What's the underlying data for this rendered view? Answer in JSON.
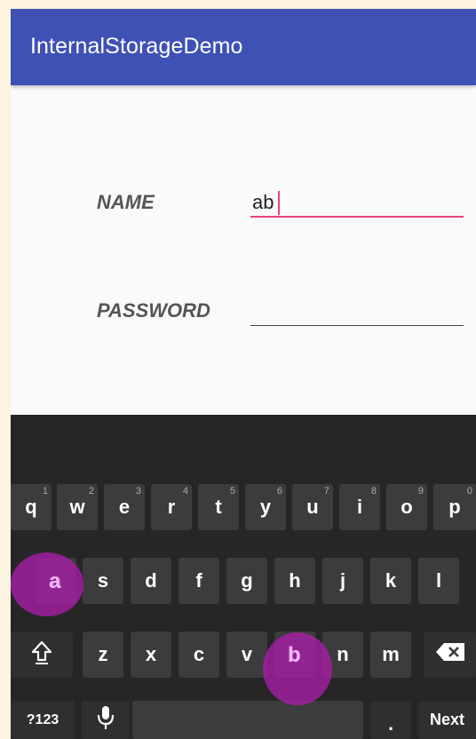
{
  "app": {
    "title": "InternalStorageDemo"
  },
  "form": {
    "name_label": "NAME",
    "name_value": "ab",
    "password_label": "PASSWORD",
    "password_value": ""
  },
  "keyboard": {
    "row1": [
      {
        "label": "q",
        "hint": "1"
      },
      {
        "label": "w",
        "hint": "2"
      },
      {
        "label": "e",
        "hint": "3"
      },
      {
        "label": "r",
        "hint": "4"
      },
      {
        "label": "t",
        "hint": "5"
      },
      {
        "label": "y",
        "hint": "6"
      },
      {
        "label": "u",
        "hint": "7"
      },
      {
        "label": "i",
        "hint": "8"
      },
      {
        "label": "o",
        "hint": "9"
      },
      {
        "label": "p",
        "hint": "0"
      }
    ],
    "row2": [
      "a",
      "s",
      "d",
      "f",
      "g",
      "h",
      "j",
      "k",
      "l"
    ],
    "row3": [
      "z",
      "x",
      "c",
      "v",
      "b",
      "n",
      "m"
    ],
    "shift_icon": "shift-arrow-icon",
    "backspace_icon": "backspace-icon",
    "mic_icon": "microphone-icon",
    "symbols_label": "?123",
    "period_label": ".",
    "action_label": "Next",
    "pressed_keys": [
      "a",
      "b"
    ]
  },
  "colors": {
    "app_bar": "#3f51b5",
    "accent": "#e6457a",
    "keyboard_bg": "#262626",
    "key_bg": "#3c3c3c",
    "touch_highlight": "#aa1eaa"
  }
}
